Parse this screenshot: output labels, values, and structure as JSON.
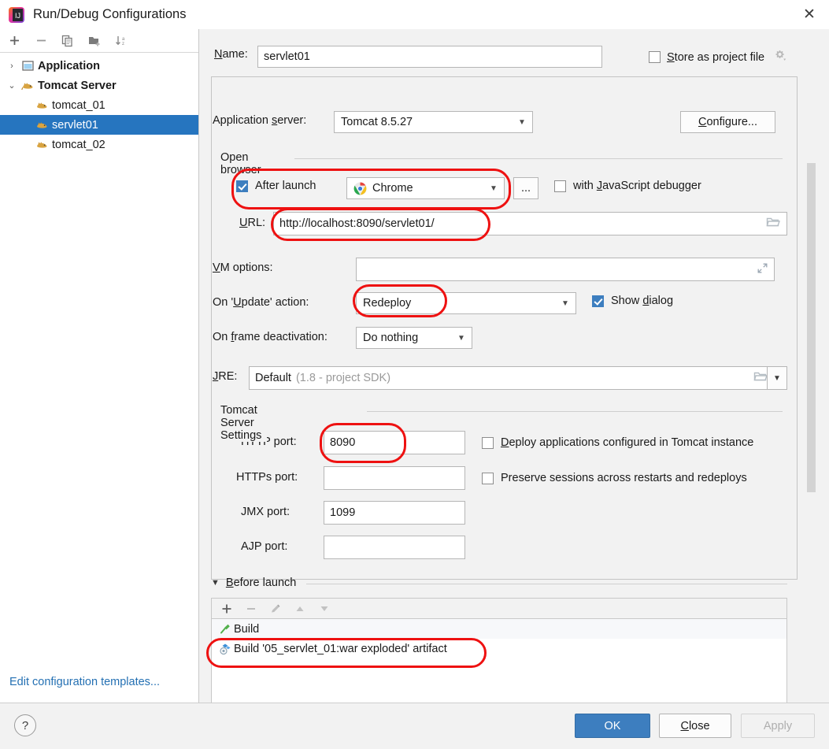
{
  "window": {
    "title": "Run/Debug Configurations",
    "logo_icon": "intellij-idea-logo",
    "close_icon": "close-icon"
  },
  "left_panel": {
    "toolbar": [
      {
        "icon": "add-icon",
        "glyph": "+"
      },
      {
        "icon": "remove-icon",
        "glyph": "−"
      },
      {
        "icon": "copy-icon",
        "glyph": "❐"
      },
      {
        "icon": "new-folder-icon",
        "glyph": "▰"
      },
      {
        "icon": "sort-alphabetically-icon",
        "glyph": "↓"
      }
    ],
    "tree": [
      {
        "label": "Application",
        "type": "group",
        "arrow": "›",
        "icon": "application-icon",
        "expanded": false,
        "selected": false
      },
      {
        "label": "Tomcat Server",
        "type": "group",
        "arrow": "⌄",
        "icon": "tomcat-icon",
        "expanded": true,
        "selected": false
      },
      {
        "label": "tomcat_01",
        "type": "child",
        "icon": "tomcat-icon",
        "selected": false
      },
      {
        "label": "servlet01",
        "type": "child",
        "icon": "tomcat-icon",
        "selected": true
      },
      {
        "label": "tomcat_02",
        "type": "child",
        "icon": "tomcat-icon",
        "selected": false
      }
    ],
    "edit_templates_link": "Edit configuration templates..."
  },
  "form": {
    "name_label": "Name:",
    "name_mnemonic": "N",
    "name_value": "servlet01",
    "store_as_project_file_label": "Store as project file",
    "store_as_project_file_mnemonic": "S",
    "store_as_project_file_checked": false,
    "store_gear_icon": "gear-icon",
    "application_server_label": "Application server:",
    "application_server_mnemonic": "s",
    "application_server_value": "Tomcat 8.5.27",
    "configure_button": "Configure...",
    "configure_mnemonic": "C",
    "open_browser_group": "Open browser",
    "after_launch_label": "After launch",
    "after_launch_checked": true,
    "browser_value": "Chrome",
    "browser_icon": "chrome-icon",
    "browser_more_button": "...",
    "with_js_debugger_label": "with JavaScript debugger",
    "with_js_debugger_mnemonic": "J",
    "with_js_debugger_checked": false,
    "url_label": "URL:",
    "url_mnemonic": "U",
    "url_value": "http://localhost:8090/servlet01/",
    "url_browse_icon": "folder-icon",
    "vm_options_label": "VM options:",
    "vm_options_mnemonic": "V",
    "vm_options_value": "",
    "vm_options_expand_icon": "expand-icon",
    "on_update_label": "On 'Update' action:",
    "on_update_mnemonic": "U",
    "on_update_value": "Redeploy",
    "show_dialog_label": "Show dialog",
    "show_dialog_mnemonic": "d",
    "show_dialog_checked": true,
    "on_frame_deactivation_label": "On frame deactivation:",
    "on_frame_deactivation_mnemonic": "f",
    "on_frame_deactivation_value": "Do nothing",
    "jre_label": "JRE:",
    "jre_mnemonic": "J",
    "jre_value": "Default",
    "jre_value_hint": "(1.8 - project SDK)",
    "jre_browse_icon": "folder-icon",
    "jre_dropdown_icon": "chevron-down-icon",
    "tomcat_settings_group": "Tomcat Server Settings",
    "http_port_label": "HTTP port:",
    "http_port_value": "8090",
    "deploy_apps_label": "Deploy applications configured in Tomcat instance",
    "deploy_apps_mnemonic": "D",
    "deploy_apps_checked": false,
    "https_port_label": "HTTPs port:",
    "https_port_value": "",
    "preserve_sessions_label": "Preserve sessions across restarts and redeploys",
    "preserve_sessions_checked": false,
    "jmx_port_label": "JMX port:",
    "jmx_port_value": "1099",
    "ajp_port_label": "AJP port:",
    "ajp_port_value": ""
  },
  "before_launch": {
    "title": "Before launch",
    "mnemonic": "B",
    "collapse_arrow": "▼",
    "toolbar": [
      {
        "icon": "add-icon",
        "glyph": "+",
        "enabled": true
      },
      {
        "icon": "remove-icon",
        "glyph": "−",
        "enabled": false
      },
      {
        "icon": "edit-pencil-icon",
        "glyph": "✎",
        "enabled": false
      },
      {
        "icon": "move-up-icon",
        "glyph": "▲",
        "enabled": false
      },
      {
        "icon": "move-down-icon",
        "glyph": "▼",
        "enabled": false
      }
    ],
    "items": [
      {
        "label": "Build",
        "icon": "build-hammer-icon"
      },
      {
        "label": "Build '05_servlet_01:war exploded' artifact",
        "icon": "artifact-icon"
      }
    ]
  },
  "bottom_bar": {
    "help_icon": "help-icon",
    "help_glyph": "?",
    "ok_label": "OK",
    "close_label": "Close",
    "close_mnemonic": "C",
    "apply_label": "Apply",
    "apply_enabled": false
  },
  "annotations": {
    "highlight_color": "#ee1111",
    "boxes": [
      "after-launch-browser",
      "url-value",
      "on-update-value",
      "http-port-value",
      "before-launch-artifact"
    ]
  },
  "colors": {
    "selection_blue": "#2675bf",
    "checkbox_blue": "#3d7ebf",
    "link_blue": "#2470b3",
    "dialog_bg": "#f2f2f2",
    "panel_white": "#ffffff"
  }
}
